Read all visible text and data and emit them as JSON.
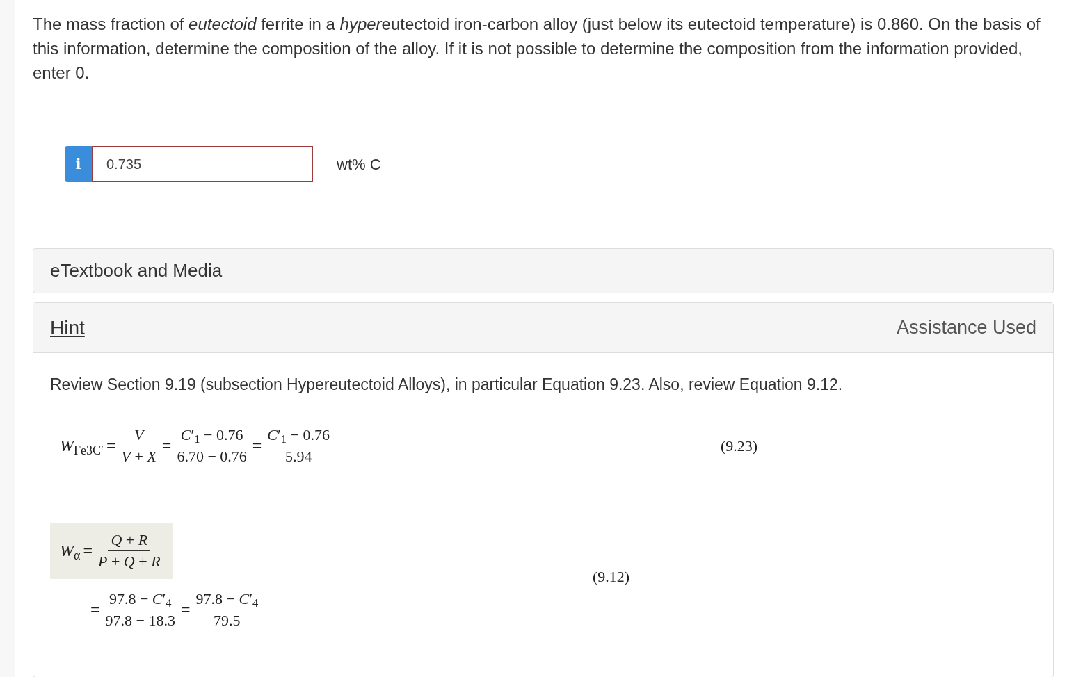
{
  "question": {
    "segments": [
      {
        "text": "The mass fraction of ",
        "italic": false
      },
      {
        "text": "eutectoid",
        "italic": true
      },
      {
        "text": " ferrite in a ",
        "italic": false
      },
      {
        "text": "hyper",
        "italic": true
      },
      {
        "text": "eutectoid iron-carbon alloy (just below its eutectoid temperature) is 0.860. On the basis of this information, determine the composition of the alloy. If it is not possible to determine the composition from the information provided, enter 0.",
        "italic": false
      }
    ]
  },
  "answer": {
    "info_label": "i",
    "value": "0.735",
    "unit": "wt% C",
    "incorrect": true
  },
  "etextbook": {
    "title": "eTextbook and Media"
  },
  "hint": {
    "link": "Hint",
    "status": "Assistance Used",
    "text": "Review Section 9.19 (subsection Hypereutectoid Alloys), in particular Equation 9.23.  Also, review Equation 9.12.",
    "equations": [
      {
        "number": "(9.23)",
        "lines": [
          {
            "highlighted": false,
            "parts": [
              {
                "kind": "lhs",
                "text": "*W*$_{Fe}$$_{3}$$_{C′}$"
              },
              {
                "kind": "operator",
                "text": "="
              },
              {
                "kind": "fraction",
                "numerator": "*V*",
                "denominator": "*V* + *X*"
              },
              {
                "kind": "operator",
                "text": "="
              },
              {
                "kind": "fraction",
                "numerator": "*C*′$_{1}$ − 0.76",
                "denominator": "6.70 − 0.76"
              },
              {
                "kind": "operator",
                "text": "="
              },
              {
                "kind": "fraction",
                "numerator": "*C*′$_{1}$ − 0.76",
                "denominator": "5.94"
              }
            ]
          }
        ]
      },
      {
        "number": "(9.12)",
        "lines": [
          {
            "highlighted": true,
            "parts": [
              {
                "kind": "lhs",
                "text": "*W*$_{α}$"
              },
              {
                "kind": "operator",
                "text": "="
              },
              {
                "kind": "fraction",
                "numerator": "*Q* + *R*",
                "denominator": "*P* + *Q* + *R*"
              }
            ]
          },
          {
            "highlighted": false,
            "parts": [
              {
                "kind": "operator",
                "text": "="
              },
              {
                "kind": "fraction",
                "numerator": "97.8 − *C*′$_{4}$",
                "denominator": "97.8 − 18.3"
              },
              {
                "kind": "operator",
                "text": "="
              },
              {
                "kind": "fraction",
                "numerator": "97.8 − *C*′$_{4}$",
                "denominator": "79.5"
              }
            ]
          }
        ]
      }
    ]
  }
}
